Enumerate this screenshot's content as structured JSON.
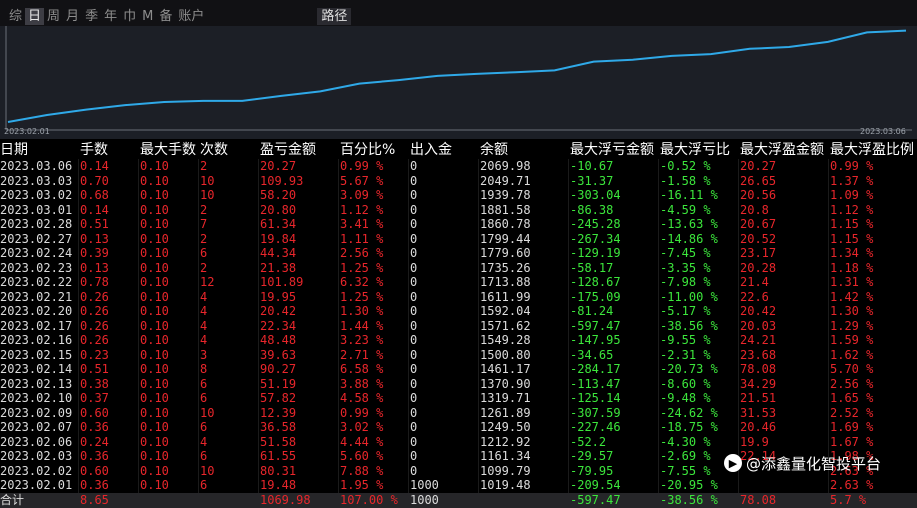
{
  "toolbar": {
    "tabs": [
      "综",
      "日",
      "周",
      "月",
      "季",
      "年",
      "巾",
      "M",
      "备",
      "账户"
    ],
    "active_tab": "日",
    "path_button": "路径"
  },
  "colors": {
    "line": "#2fa9e8",
    "up": "#e8262b",
    "down": "#3ce63c",
    "text": "#dcdcdc"
  },
  "chart_data": {
    "type": "line",
    "x": [
      "2023.02.01",
      "2023.02.02",
      "2023.02.03",
      "2023.02.06",
      "2023.02.07",
      "2023.02.08",
      "2023.02.09",
      "2023.02.10",
      "2023.02.13",
      "2023.02.14",
      "2023.02.15",
      "2023.02.16",
      "2023.02.17",
      "2023.02.20",
      "2023.02.21",
      "2023.02.22",
      "2023.02.23",
      "2023.02.24",
      "2023.02.27",
      "2023.02.28",
      "2023.03.01",
      "2023.03.02",
      "2023.03.03",
      "2023.03.06"
    ],
    "series": [
      {
        "values": [
          1019.48,
          1099.79,
          1161.34,
          1212.92,
          1249.5,
          1261.89,
          1261.89,
          1319.71,
          1370.9,
          1461.17,
          1500.8,
          1549.28,
          1571.62,
          1592.04,
          1611.99,
          1713.88,
          1735.26,
          1779.6,
          1799.44,
          1860.78,
          1881.58,
          1939.78,
          2049.71,
          2069.98
        ]
      }
    ],
    "x_start_label": "2023.02.01",
    "x_end_label": "2023.03.06",
    "ylim": [
      950,
      2100
    ],
    "grid": false
  },
  "table": {
    "headers": [
      "日期",
      "手数",
      "最大手数",
      "次数",
      "盈亏金额",
      "百分比%",
      "出入金",
      "余额",
      "最大浮亏金额",
      "最大浮亏比",
      "最大浮盈金额",
      "最大浮盈比例"
    ],
    "rows": [
      [
        "2023.03.06",
        "0.14",
        "0.10",
        "2",
        "20.27",
        "0.99 %",
        "0",
        "2069.98",
        "-10.67",
        "-0.52 %",
        "20.27",
        "0.99 %"
      ],
      [
        "2023.03.03",
        "0.70",
        "0.10",
        "10",
        "109.93",
        "5.67 %",
        "0",
        "2049.71",
        "-31.37",
        "-1.58 %",
        "26.65",
        "1.37 %"
      ],
      [
        "2023.03.02",
        "0.68",
        "0.10",
        "10",
        "58.20",
        "3.09 %",
        "0",
        "1939.78",
        "-303.04",
        "-16.11 %",
        "20.56",
        "1.09 %"
      ],
      [
        "2023.03.01",
        "0.14",
        "0.10",
        "2",
        "20.80",
        "1.12 %",
        "0",
        "1881.58",
        "-86.38",
        "-4.59 %",
        "20.8",
        "1.12 %"
      ],
      [
        "2023.02.28",
        "0.51",
        "0.10",
        "7",
        "61.34",
        "3.41 %",
        "0",
        "1860.78",
        "-245.28",
        "-13.63 %",
        "20.67",
        "1.15 %"
      ],
      [
        "2023.02.27",
        "0.13",
        "0.10",
        "2",
        "19.84",
        "1.11 %",
        "0",
        "1799.44",
        "-267.34",
        "-14.86 %",
        "20.52",
        "1.15 %"
      ],
      [
        "2023.02.24",
        "0.39",
        "0.10",
        "6",
        "44.34",
        "2.56 %",
        "0",
        "1779.60",
        "-129.19",
        "-7.45 %",
        "23.17",
        "1.34 %"
      ],
      [
        "2023.02.23",
        "0.13",
        "0.10",
        "2",
        "21.38",
        "1.25 %",
        "0",
        "1735.26",
        "-58.17",
        "-3.35 %",
        "20.28",
        "1.18 %"
      ],
      [
        "2023.02.22",
        "0.78",
        "0.10",
        "12",
        "101.89",
        "6.32 %",
        "0",
        "1713.88",
        "-128.67",
        "-7.98 %",
        "21.4",
        "1.31 %"
      ],
      [
        "2023.02.21",
        "0.26",
        "0.10",
        "4",
        "19.95",
        "1.25 %",
        "0",
        "1611.99",
        "-175.09",
        "-11.00 %",
        "22.6",
        "1.42 %"
      ],
      [
        "2023.02.20",
        "0.26",
        "0.10",
        "4",
        "20.42",
        "1.30 %",
        "0",
        "1592.04",
        "-81.24",
        "-5.17 %",
        "20.42",
        "1.30 %"
      ],
      [
        "2023.02.17",
        "0.26",
        "0.10",
        "4",
        "22.34",
        "1.44 %",
        "0",
        "1571.62",
        "-597.47",
        "-38.56 %",
        "20.03",
        "1.29 %"
      ],
      [
        "2023.02.16",
        "0.26",
        "0.10",
        "4",
        "48.48",
        "3.23 %",
        "0",
        "1549.28",
        "-147.95",
        "-9.55 %",
        "24.21",
        "1.59 %"
      ],
      [
        "2023.02.15",
        "0.23",
        "0.10",
        "3",
        "39.63",
        "2.71 %",
        "0",
        "1500.80",
        "-34.65",
        "-2.31 %",
        "23.68",
        "1.62 %"
      ],
      [
        "2023.02.14",
        "0.51",
        "0.10",
        "8",
        "90.27",
        "6.58 %",
        "0",
        "1461.17",
        "-284.17",
        "-20.73 %",
        "78.08",
        "5.70 %"
      ],
      [
        "2023.02.13",
        "0.38",
        "0.10",
        "6",
        "51.19",
        "3.88 %",
        "0",
        "1370.90",
        "-113.47",
        "-8.60 %",
        "34.29",
        "2.56 %"
      ],
      [
        "2023.02.10",
        "0.37",
        "0.10",
        "6",
        "57.82",
        "4.58 %",
        "0",
        "1319.71",
        "-125.14",
        "-9.48 %",
        "21.51",
        "1.65 %"
      ],
      [
        "2023.02.09",
        "0.60",
        "0.10",
        "10",
        "12.39",
        "0.99 %",
        "0",
        "1261.89",
        "-307.59",
        "-24.62 %",
        "31.53",
        "2.52 %"
      ],
      [
        "2023.02.07",
        "0.36",
        "0.10",
        "6",
        "36.58",
        "3.02 %",
        "0",
        "1249.50",
        "-227.46",
        "-18.75 %",
        "20.46",
        "1.69 %"
      ],
      [
        "2023.02.06",
        "0.24",
        "0.10",
        "4",
        "51.58",
        "4.44 %",
        "0",
        "1212.92",
        "-52.2",
        "-4.30 %",
        "19.9",
        "1.67 %"
      ],
      [
        "2023.02.03",
        "0.36",
        "0.10",
        "6",
        "61.55",
        "5.60 %",
        "0",
        "1161.34",
        "-29.57",
        "-2.69 %",
        "22.14",
        "1.98 %"
      ],
      [
        "2023.02.02",
        "0.60",
        "0.10",
        "10",
        "80.31",
        "7.88 %",
        "0",
        "1099.79",
        "-79.95",
        "-7.55 %",
        "",
        "2.63 %"
      ],
      [
        "2023.02.01",
        "0.36",
        "0.10",
        "6",
        "19.48",
        "1.95 %",
        "1000",
        "1019.48",
        "-209.54",
        "-20.95 %",
        "",
        "2.63 %"
      ]
    ],
    "total": [
      "合计",
      "8.65",
      "",
      "",
      "1069.98",
      "107.00 %",
      "1000",
      "",
      "-597.47",
      "-38.56 %",
      "78.08",
      "5.7 %"
    ]
  },
  "watermark": {
    "text": "@添鑫量化智投平台",
    "icon": "bilibili-circle-icon"
  }
}
